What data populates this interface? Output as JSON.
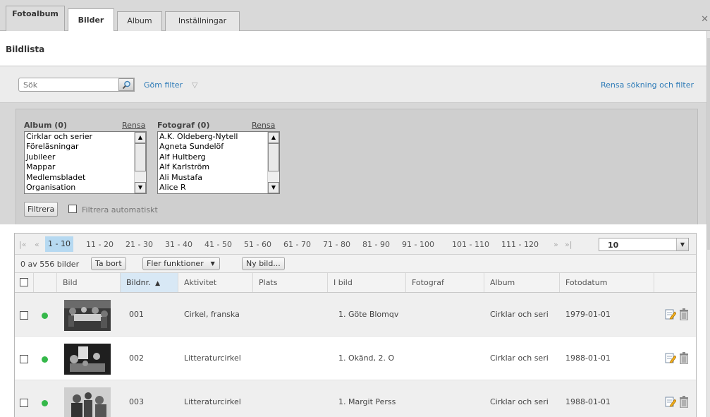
{
  "tabs": [
    {
      "label": "Fotoalbum"
    },
    {
      "label": "Bilder"
    },
    {
      "label": "Album"
    },
    {
      "label": "Inställningar"
    }
  ],
  "page_title": "Bildlista",
  "search": {
    "placeholder": "Sök"
  },
  "filter": {
    "hide_label": "Göm filter",
    "clear_all": "Rensa sökning och filter",
    "album": {
      "label": "Album (0)",
      "clear": "Rensa",
      "options": [
        "Cirklar och serier",
        "Föreläsningar",
        "Jubileer",
        "Mappar",
        "Medlemsbladet",
        "Organisation"
      ]
    },
    "photographer": {
      "label": "Fotograf (0)",
      "clear": "Rensa",
      "options": [
        "A.K. Oldeberg-Nytell",
        "Agneta Sundelöf",
        "Alf Hultberg",
        "Alf Karlström",
        "Ali Mustafa",
        "Alice R"
      ]
    },
    "filter_button": "Filtrera",
    "auto_filter": "Filtrera automatiskt"
  },
  "pager": {
    "first": "|«",
    "prev": "«",
    "pages": [
      "1 - 10",
      "11 - 20",
      "21 - 30",
      "31 - 40",
      "41 - 50",
      "51 - 60",
      "61 - 70",
      "71 - 80",
      "81 - 90",
      "91 - 100",
      "101 - 110",
      "111 - 120"
    ],
    "next": "»",
    "last": "»|",
    "per_page": "10"
  },
  "toolbar": {
    "count": "0 av 556 bilder",
    "delete": "Ta bort",
    "more": "Fler funktioner",
    "new": "Ny bild..."
  },
  "columns": [
    "Bild",
    "Bildnr.",
    "Aktivitet",
    "Plats",
    "I bild",
    "Fotograf",
    "Album",
    "Fotodatum"
  ],
  "rows": [
    {
      "nr": "001",
      "activity": "Cirkel, franska",
      "place": "",
      "in_image": "1. Göte Blomqv",
      "photographer": "",
      "album": "Cirklar och seri",
      "date": "1979-01-01"
    },
    {
      "nr": "002",
      "activity": "Litteraturcirkel",
      "place": "",
      "in_image": "1. Okänd, 2. O",
      "photographer": "",
      "album": "Cirklar och seri",
      "date": "1988-01-01"
    },
    {
      "nr": "003",
      "activity": "Litteraturcirkel",
      "place": "",
      "in_image": "1. Margit Perss",
      "photographer": "",
      "album": "Cirklar och seri",
      "date": "1988-01-01"
    }
  ],
  "colors": {
    "link": "#2c7ab7",
    "active_page": "#b6d9f1",
    "status_dot": "#35b84a"
  }
}
